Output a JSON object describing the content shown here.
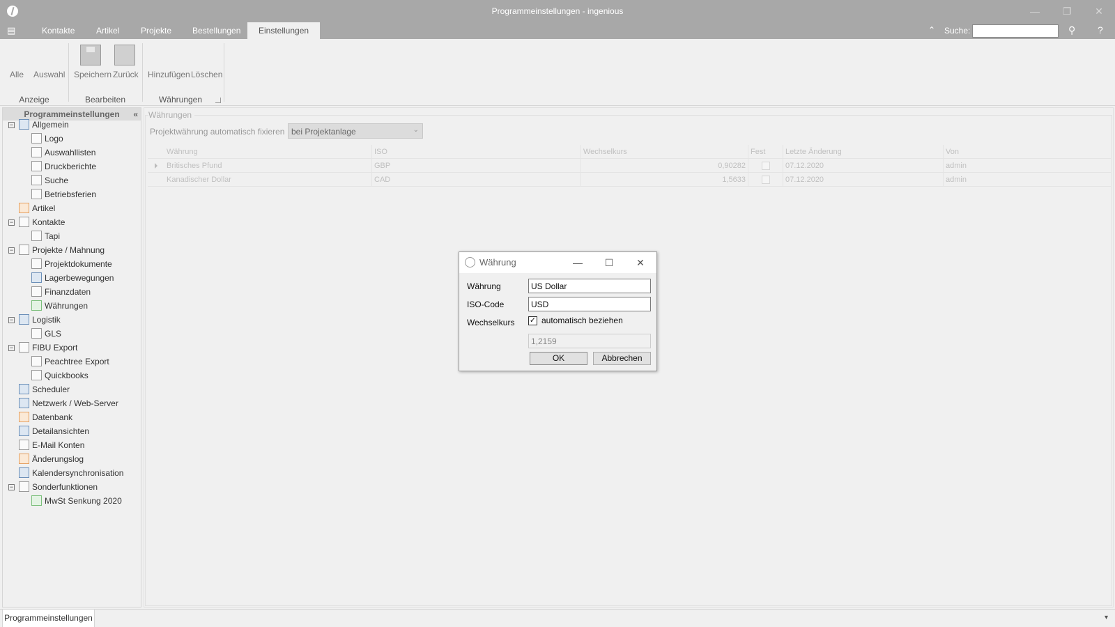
{
  "window": {
    "title": "Programmeinstellungen - ingenious",
    "min_glyph": "—",
    "max_glyph": "❐",
    "close_glyph": "✕"
  },
  "menu": {
    "toggle_glyph": "▤",
    "tabs": [
      "Kontakte",
      "Artikel",
      "Projekte",
      "Bestellungen",
      "Einstellungen"
    ],
    "active_tab": "Einstellungen",
    "search_label": "Suche:",
    "search_value": "",
    "collapse_glyph": "⌃",
    "search_icon_glyph": "⚲",
    "help_glyph": "?"
  },
  "ribbon": {
    "buttons": {
      "alle": "Alle",
      "auswahl": "Auswahl",
      "speichern": "Speichern",
      "zurueck": "Zurück",
      "hinzufuegen": "Hinzufügen",
      "loeschen": "Löschen"
    },
    "groups": {
      "anzeige": "Anzeige",
      "bearbeiten": "Bearbeiten",
      "waehrungen": "Währungen"
    }
  },
  "sidebar": {
    "title": "Programmeinstellungen",
    "collapse_glyph": "«",
    "items": [
      {
        "label": "Allgemein",
        "expander": "⊟"
      },
      {
        "label": "Logo"
      },
      {
        "label": "Auswahllisten"
      },
      {
        "label": "Druckberichte"
      },
      {
        "label": "Suche"
      },
      {
        "label": "Betriebsferien"
      },
      {
        "label": "Artikel"
      },
      {
        "label": "Kontakte",
        "expander": "⊟"
      },
      {
        "label": "Tapi"
      },
      {
        "label": "Projekte / Mahnung",
        "expander": "⊟"
      },
      {
        "label": "Projektdokumente"
      },
      {
        "label": "Lagerbewegungen"
      },
      {
        "label": "Finanzdaten"
      },
      {
        "label": "Währungen"
      },
      {
        "label": "Logistik",
        "expander": "⊟"
      },
      {
        "label": "GLS"
      },
      {
        "label": "FIBU Export",
        "expander": "⊟"
      },
      {
        "label": "Peachtree Export"
      },
      {
        "label": "Quickbooks"
      },
      {
        "label": "Scheduler"
      },
      {
        "label": "Netzwerk / Web-Server"
      },
      {
        "label": "Datenbank"
      },
      {
        "label": "Detailansichten"
      },
      {
        "label": "E-Mail Konten"
      },
      {
        "label": "Änderungslog"
      },
      {
        "label": "Kalendersynchronisation"
      },
      {
        "label": "Sonderfunktionen",
        "expander": "⊟"
      },
      {
        "label": "MwSt Senkung 2020"
      }
    ]
  },
  "main": {
    "group_title": "Währungen",
    "fix_label": "Projektwährung automatisch fixieren",
    "fix_value": "bei Projektanlage",
    "dropdown_glyph": "⌄",
    "grid": {
      "columns": [
        "Währung",
        "ISO",
        "Wechselkurs",
        "Fest",
        "Letzte Änderung",
        "Von"
      ],
      "rows": [
        {
          "waehrung": "Britisches Pfund",
          "iso": "GBP",
          "kurs": "0,90282",
          "fest": false,
          "datum": "07.12.2020",
          "von": "admin"
        },
        {
          "waehrung": "Kanadischer Dollar",
          "iso": "CAD",
          "kurs": "1,5633",
          "fest": false,
          "datum": "07.12.2020",
          "von": "admin"
        }
      ]
    }
  },
  "dialog": {
    "title": "Währung",
    "min_glyph": "—",
    "max_glyph": "☐",
    "close_glyph": "✕",
    "label_waehrung": "Währung",
    "value_waehrung": "US Dollar",
    "label_iso": "ISO-Code",
    "value_iso": "USD",
    "label_kurs": "Wechselkurs",
    "auto_label": "automatisch beziehen",
    "auto_checked_glyph": "✓",
    "kurs_value": "1,2159",
    "ok_label": "OK",
    "cancel_label": "Abbrechen"
  },
  "bottom": {
    "tab_label": "Programmeinstellungen",
    "arrow_glyph": "▾"
  }
}
